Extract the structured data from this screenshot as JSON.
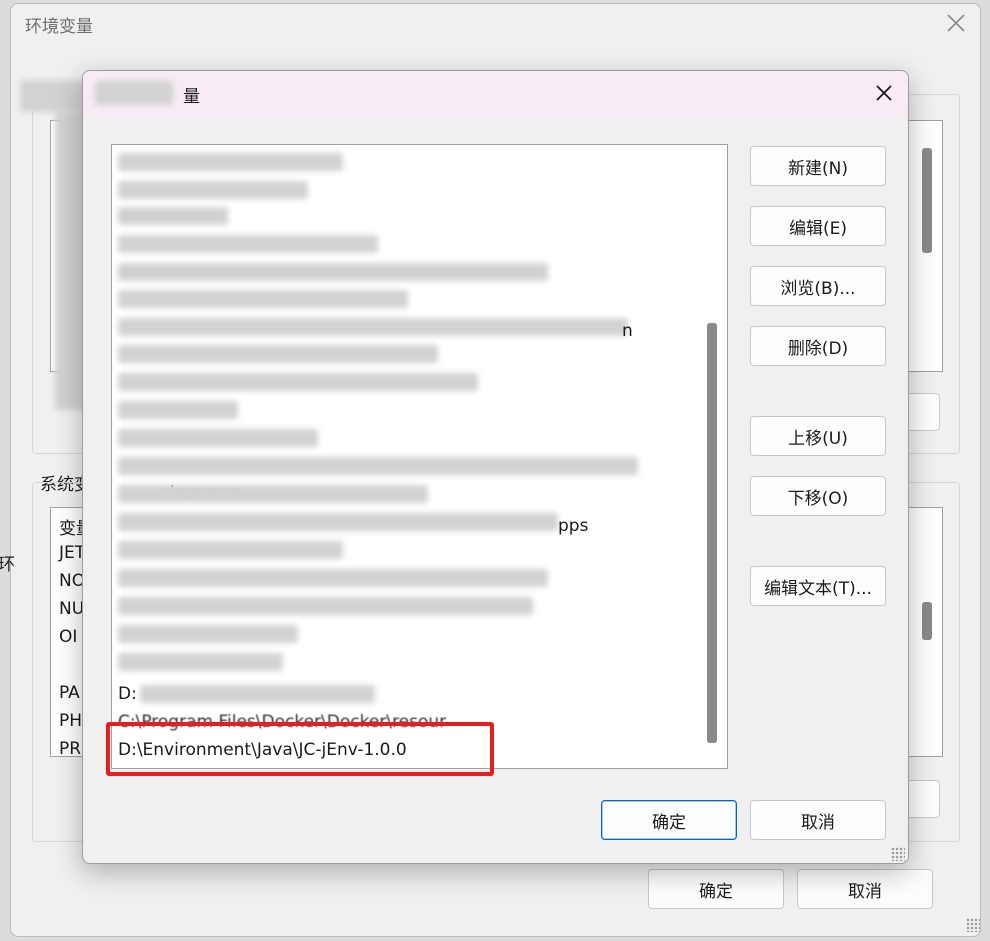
{
  "outer": {
    "title": "环境变量",
    "system_section_label": "系统变",
    "left_edge_label": "环",
    "list_rows": [
      "变量",
      "JET",
      "NO",
      "NU",
      "OI",
      "PA",
      "PH",
      "PR"
    ],
    "ok": "确定",
    "cancel": "取消"
  },
  "dialog": {
    "title": "量",
    "buttons": {
      "new": "新建(N)",
      "edit": "编辑(E)",
      "browse": "浏览(B)...",
      "delete": "删除(D)",
      "move_up": "上移(U)",
      "move_down": "下移(O)",
      "edit_text": "编辑文本(T)..."
    },
    "ok": "确定",
    "cancel": "取消",
    "path_fragments": {
      "environment_fragment": "vironmen",
      "n_fragment": "n",
      "apps_fragment": "pps",
      "d_prefix": "D:",
      "docker_path": "C:\\Program Files\\Docker\\Docker\\resour",
      "highlighted_path": "D:\\Environment\\Java\\JC-jEnv-1.0.0"
    }
  },
  "colors": {
    "highlight_box": "#e32020",
    "title_bar": "#f7ecf5",
    "primary_border": "#0067c0"
  }
}
